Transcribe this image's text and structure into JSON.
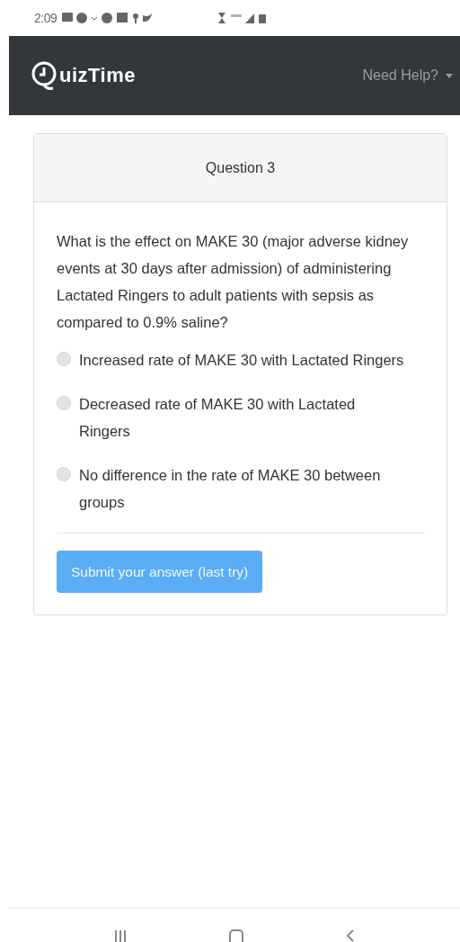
{
  "status_bar": {
    "time": "2:09"
  },
  "navbar": {
    "brand": "uizTime",
    "help_menu": "Need Help?"
  },
  "card": {
    "header": "Question 3",
    "question": "What is the effect on MAKE 30 (major adverse kidney events at 30 days after admission) of administering Lactated Ringers to adult patients with sepsis as compared to 0.9% saline?",
    "options": [
      {
        "label": "Increased rate of MAKE 30 with Lactated Ringers",
        "selected": false
      },
      {
        "label": "Decreased rate of MAKE 30 with Lactated Ringers",
        "selected": false
      },
      {
        "label": "No difference in the rate of MAKE 30 between groups",
        "selected": false
      }
    ],
    "submit": {
      "label": "Submit your answer (last try)",
      "disabled": true
    }
  }
}
